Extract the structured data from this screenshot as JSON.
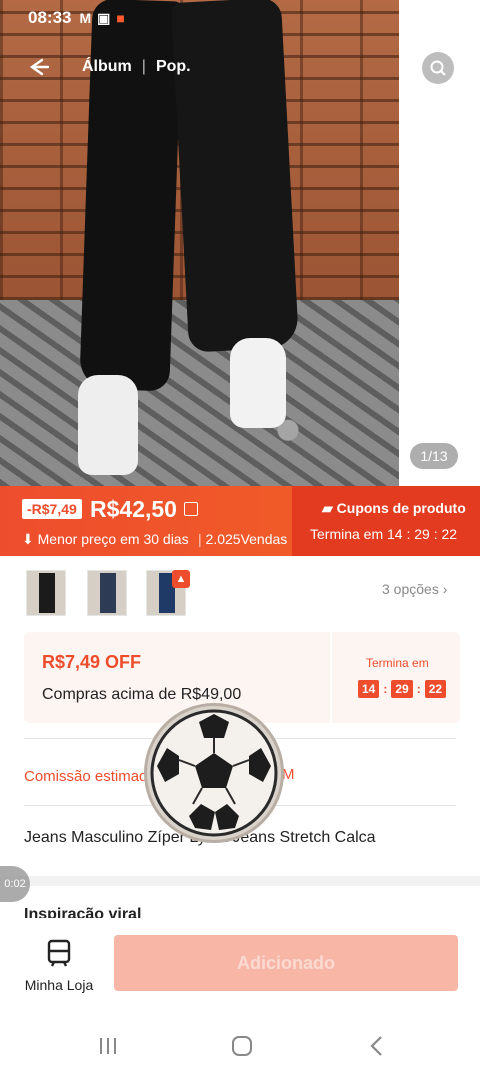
{
  "status_bar": {
    "time": "08:33"
  },
  "nav": {
    "tab_album": "Álbum",
    "tab_separator": "|",
    "tab_pop": "Pop.",
    "image_counter": "1/13"
  },
  "price": {
    "discount": "-R$7,49",
    "current": "R$42,50",
    "lowest_note": "Menor preço em 30 dias",
    "separator": "|",
    "sales": "2.025Vendas",
    "coupon_title": "Cupons de produto",
    "coupon_ends": "Termina em 14 : 29 : 22"
  },
  "variants": {
    "options_label": "3 opções",
    "count": 3
  },
  "coupon_card": {
    "amount": "R$7,49 OFF",
    "min_spend": "Compras acima de R$49,00",
    "ends_label": "Termina em",
    "hours": "14",
    "minutes": "29",
    "seconds": "22"
  },
  "commission": {
    "label": "Comissão estimada",
    "value_fragment": "M"
  },
  "product": {
    "title": "Jeans Masculino Zíper Lycra Jeans Stretch Calca"
  },
  "section": {
    "title": "Inspiração viral"
  },
  "video": {
    "time": "0:02"
  },
  "bottom_bar": {
    "store_label": "Minha Loja",
    "add_button": "Adicionado"
  },
  "colors": {
    "accent": "#ee4d2d",
    "button_disabled": "#f7b6a6"
  }
}
